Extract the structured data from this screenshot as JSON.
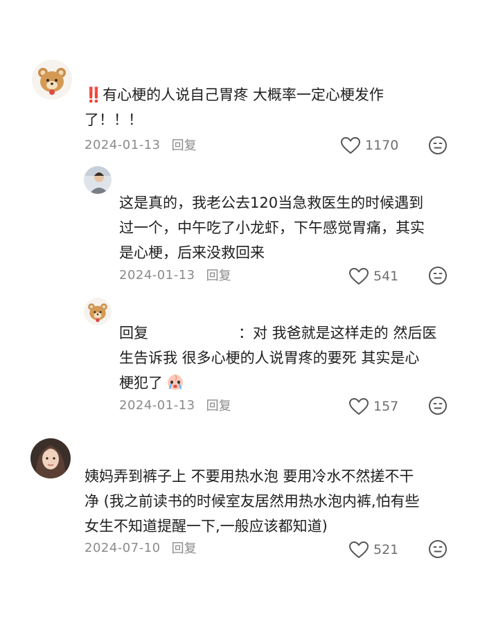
{
  "comments": [
    {
      "text_lines": [
        "‼️有心梗的人说自己胃疼 大概率一定心梗发作",
        "了！！！"
      ],
      "date": "2024-01-13",
      "reply_label": "回复",
      "likes": "1170"
    },
    {
      "text_lines": [
        "这是真的，我老公去120当急救医生的时候遇到",
        "过一个，中午吃了小龙虾，下午感觉胃痛，其实",
        "是心梗，后来没救回来"
      ],
      "date": "2024-01-13",
      "reply_label": "回复",
      "likes": "541"
    },
    {
      "reply_prefix": "回复",
      "text_line1_suffix": "：对 我爸就是这样走的 然后医",
      "text_lines_rest": [
        "生告诉我 很多心梗的人说胃疼的要死 其实是心"
      ],
      "text_last": "梗犯了",
      "date": "2024-01-13",
      "reply_label": "回复",
      "likes": "157"
    },
    {
      "text_lines": [
        "姨妈弄到裤子上 不要用热水泡 要用冷水不然搓不干",
        "净 (我之前读书的时候室友居然用热水泡内裤,怕有些",
        "女生不知道提醒一下,一般应该都知道)"
      ],
      "date": "2024-07-10",
      "reply_label": "回复",
      "likes": "521"
    }
  ],
  "icons": {
    "like": "heart-outline-icon",
    "react": "neutral-face-icon",
    "inline_emoji": "crying-peach-emoji"
  },
  "colors": {
    "text": "#1e1e1e",
    "meta": "#8a8a8a",
    "icon": "#555555",
    "exclaim": "#e0301e"
  }
}
